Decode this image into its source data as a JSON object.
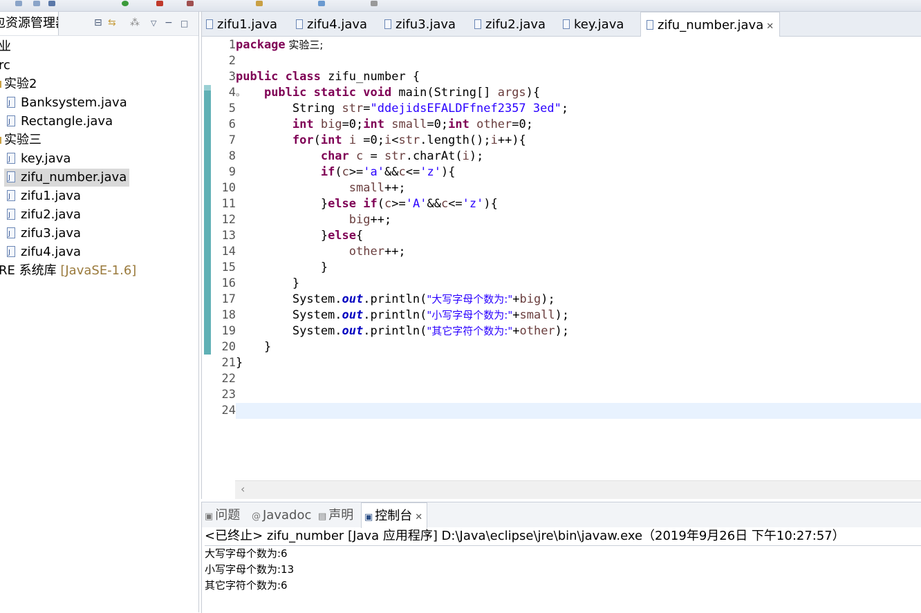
{
  "explorer": {
    "title": "包资源管理器",
    "items": [
      {
        "label": "业"
      },
      {
        "label": "rc"
      },
      {
        "label": "实验2"
      },
      {
        "label": "Banksystem.java"
      },
      {
        "label": "Rectangle.java"
      },
      {
        "label": "实验三"
      },
      {
        "label": "key.java"
      },
      {
        "label": "zifu_number.java"
      },
      {
        "label": "zifu1.java"
      },
      {
        "label": "zifu2.java"
      },
      {
        "label": "zifu3.java"
      },
      {
        "label": "zifu4.java"
      },
      {
        "label": "RE 系统库",
        "tag": "[JavaSE-1.6]"
      }
    ]
  },
  "editor": {
    "tabs": [
      {
        "label": "zifu1.java"
      },
      {
        "label": "zifu4.java"
      },
      {
        "label": "zifu3.java"
      },
      {
        "label": "zifu2.java"
      },
      {
        "label": "key.java"
      },
      {
        "label": "zifu_number.java"
      }
    ],
    "line_numbers": [
      "1",
      "2",
      "3",
      "4",
      "5",
      "6",
      "7",
      "8",
      "9",
      "10",
      "11",
      "12",
      "13",
      "14",
      "15",
      "16",
      "17",
      "18",
      "19",
      "20",
      "21",
      "22",
      "23",
      "24"
    ]
  },
  "code": {
    "l1_kw": "package",
    "l1_rest": " 实验三;",
    "l3_kw1": "public",
    "l3_kw2": "class",
    "l3_rest": " zifu_number {",
    "l4_indent": "    ",
    "l4_kw": "public static void",
    "l4_rest": " main(String[] ",
    "l4_var": "args",
    "l4_end": "){",
    "l5_a": "        String ",
    "l5_var": "str",
    "l5_eq": "=",
    "l5_str": "\"ddejidsEFALDFfnef2357 3ed\"",
    "l5_end": ";",
    "l6_a": "        ",
    "l6_k1": "int",
    "l6_v1": " big",
    "l6_b": "=0;",
    "l6_k2": "int",
    "l6_v2": " small",
    "l6_c": "=0;",
    "l6_k3": "int",
    "l6_v3": " other",
    "l6_d": "=0;",
    "l7_a": "        ",
    "l7_k1": "for",
    "l7_b": "(",
    "l7_k2": "int",
    "l7_v1": " i",
    "l7_c": " =0;",
    "l7_v2": "i",
    "l7_d": "<",
    "l7_v3": "str",
    "l7_e": ".length();",
    "l7_v4": "i",
    "l7_f": "++){",
    "l8_a": "            ",
    "l8_k": "char",
    "l8_v": " c",
    "l8_b": " = ",
    "l8_v2": "str",
    "l8_c": ".charAt(",
    "l8_v3": "i",
    "l8_d": ");",
    "l9_a": "            ",
    "l9_k": "if",
    "l9_b": "(",
    "l9_v": "c",
    "l9_c": ">=",
    "l9_s1": "'a'",
    "l9_d": "&&",
    "l9_v2": "c",
    "l9_e": "<=",
    "l9_s2": "'z'",
    "l9_f": "){",
    "l10_a": "                ",
    "l10_v": "small",
    "l10_b": "++;",
    "l11_a": "            }",
    "l11_k1": "else",
    "l11_b": " ",
    "l11_k2": "if",
    "l11_c": "(",
    "l11_v": "c",
    "l11_d": ">=",
    "l11_s1": "'A'",
    "l11_e": "&&",
    "l11_v2": "c",
    "l11_f": "<=",
    "l11_s2": "'z'",
    "l11_g": "){",
    "l12_a": "                ",
    "l12_v": "big",
    "l12_b": "++;",
    "l13_a": "            }",
    "l13_k": "else",
    "l13_b": "{",
    "l14_a": "                ",
    "l14_v": "other",
    "l14_b": "++;",
    "l15": "            }",
    "l16": "        }",
    "l17_a": "        System.",
    "l17_f": "out",
    "l17_b": ".println(",
    "l17_s": "\"大写字母个数为:\"",
    "l17_c": "+",
    "l17_v": "big",
    "l17_d": ");",
    "l18_a": "        System.",
    "l18_f": "out",
    "l18_b": ".println(",
    "l18_s": "\"小写字母个数为:\"",
    "l18_c": "+",
    "l18_v": "small",
    "l18_d": ");",
    "l19_a": "        System.",
    "l19_f": "out",
    "l19_b": ".println(",
    "l19_s": "\"其它字符个数为:\"",
    "l19_c": "+",
    "l19_v": "other",
    "l19_d": ");",
    "l20": "    }",
    "l21": "}"
  },
  "console": {
    "tabs": [
      {
        "label": "问题"
      },
      {
        "label": "Javadoc"
      },
      {
        "label": "声明"
      },
      {
        "label": "控制台"
      }
    ],
    "status": "<已终止> zifu_number [Java 应用程序] D:\\Java\\eclipse\\jre\\bin\\javaw.exe（2019年9月26日 下午10:27:57）",
    "output": [
      "大写字母个数为:6",
      "小写字母个数为:13",
      "其它字符个数为:6"
    ]
  },
  "colors": {
    "keyword": "#7f0055",
    "string": "#2a00ff",
    "field": "#0000c0",
    "change_bar": "#5fb0b5",
    "current_line": "#e8f2fe"
  }
}
